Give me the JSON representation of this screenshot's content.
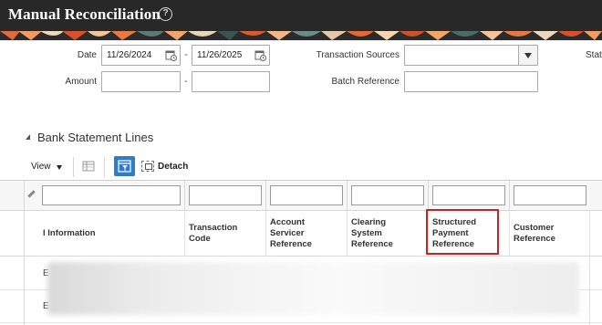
{
  "header": {
    "title": "Manual Reconciliation",
    "help_icon": "?"
  },
  "search": {
    "date_label": "Date",
    "date_from": "11/26/2024",
    "date_to": "11/26/2025",
    "range_dash": "-",
    "amount_label": "Amount",
    "amount_from": "",
    "amount_to": "",
    "transaction_sources_label": "Transaction Sources",
    "transaction_sources_value": "",
    "batch_reference_label": "Batch Reference",
    "batch_reference_value": "",
    "cut_off_label": "Stat"
  },
  "section": {
    "title": "Bank Statement Lines"
  },
  "toolbar": {
    "view_label": "View",
    "detach_label": "Detach"
  },
  "table": {
    "columns": [
      {
        "label": "l Information"
      },
      {
        "label": "Transaction\nCode"
      },
      {
        "label": "Account\nServicer\nReference"
      },
      {
        "label": "Clearing\nSystem\nReference"
      },
      {
        "label": "Structured\nPayment\nReference",
        "highlighted": true
      },
      {
        "label": "Customer\nReference"
      }
    ],
    "rows": [
      {
        "lead": "E"
      },
      {
        "lead": "E"
      }
    ]
  },
  "colors": {
    "titlebar": "#282828",
    "highlight_box": "#d01f1f",
    "filter_button": "#2f7cc7"
  }
}
